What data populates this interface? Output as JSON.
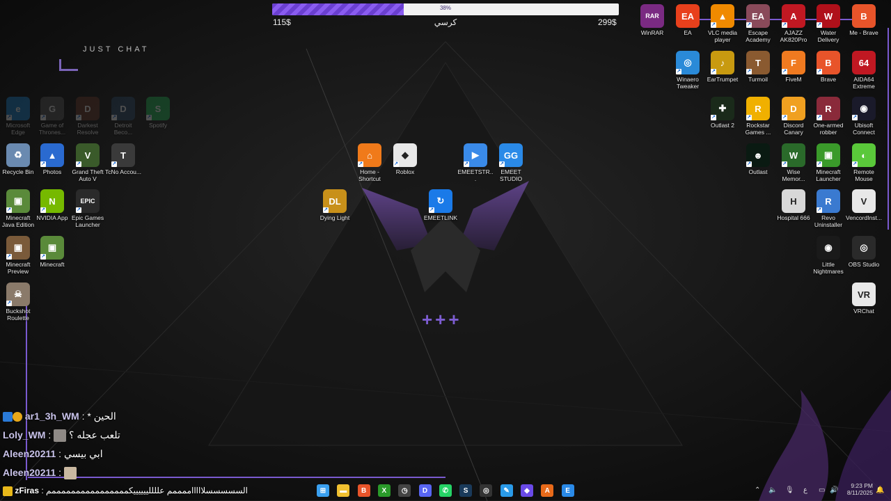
{
  "goal": {
    "percent_label": "38%",
    "progress": 0.38,
    "left_value": "115$",
    "title": "كرسي",
    "right_value": "299$"
  },
  "overlay": {
    "just_chat": "JUST CHAT",
    "plus": "+++"
  },
  "desktop_icons": [
    {
      "id": "winrar",
      "label": "WinRAR",
      "color": "#7a2a82",
      "glyph": "RAR"
    },
    {
      "id": "ea",
      "label": "EA",
      "color": "#e8401c",
      "glyph": "EA"
    },
    {
      "id": "vlc",
      "label": "VLC media player",
      "color": "#f08a00",
      "glyph": "▲"
    },
    {
      "id": "escape",
      "label": "Escape Academy",
      "color": "#8a4a5a",
      "glyph": "EA"
    },
    {
      "id": "ajazz",
      "label": "AJAZZ AK820Pro",
      "color": "#c01822",
      "glyph": "A"
    },
    {
      "id": "water",
      "label": "Water Delivery",
      "color": "#b0101a",
      "glyph": "W"
    },
    {
      "id": "brave-me",
      "label": "Me - Brave",
      "color": "#e8542a",
      "glyph": "B"
    },
    {
      "id": "winaero",
      "label": "Winaero Tweaker",
      "color": "#2a8ad8",
      "glyph": "◎"
    },
    {
      "id": "eartrumpet",
      "label": "EarTrumpet",
      "color": "#c89a10",
      "glyph": "♪"
    },
    {
      "id": "turmoil",
      "label": "Turmoil",
      "color": "#8a5a30",
      "glyph": "T"
    },
    {
      "id": "fivem",
      "label": "FiveM",
      "color": "#f07a20",
      "glyph": "F"
    },
    {
      "id": "brave",
      "label": "Brave",
      "color": "#e8542a",
      "glyph": "B"
    },
    {
      "id": "aida",
      "label": "AIDA64 Extreme",
      "color": "#c01822",
      "glyph": "64"
    },
    {
      "id": "outlast2",
      "label": "Outlast 2",
      "color": "#1a2a1a",
      "glyph": "✚"
    },
    {
      "id": "rockstar",
      "label": "Rockstar Games ...",
      "color": "#f0b000",
      "glyph": "R"
    },
    {
      "id": "discord-canary",
      "label": "Discord Canary",
      "color": "#f0a020",
      "glyph": "D"
    },
    {
      "id": "one-armed",
      "label": "One-armed robber",
      "color": "#8a2a3a",
      "glyph": "R"
    },
    {
      "id": "ubisoft",
      "label": "Ubisoft Connect",
      "color": "#1a1a2a",
      "glyph": "◉"
    },
    {
      "id": "outlast",
      "label": "Outlast",
      "color": "#0a1a12",
      "glyph": "☻"
    },
    {
      "id": "wise",
      "label": "Wise Memor...",
      "color": "#2a6a2a",
      "glyph": "W"
    },
    {
      "id": "mclauncher",
      "label": "Minecraft Launcher",
      "color": "#3a9a2a",
      "glyph": "▣"
    },
    {
      "id": "remote",
      "label": "Remote Mouse",
      "color": "#5ac83a",
      "glyph": "◐"
    },
    {
      "id": "hospital",
      "label": "Hospital 666",
      "color": "#d8d8d8",
      "glyph": "H"
    },
    {
      "id": "revo",
      "label": "Revo Uninstaller",
      "color": "#3a7ad0",
      "glyph": "R"
    },
    {
      "id": "vencord",
      "label": "VencordInst...",
      "color": "#e8e8e8",
      "glyph": "V"
    },
    {
      "id": "little",
      "label": "Little Nightmares",
      "color": "#1a1a1a",
      "glyph": "◉"
    },
    {
      "id": "obs",
      "label": "OBS Studio",
      "color": "#2a2a2a",
      "glyph": "◎"
    },
    {
      "id": "vrchat",
      "label": "VRChat",
      "color": "#e8e8e8",
      "glyph": "VR"
    },
    {
      "id": "edge",
      "label": "Microsoft Edge",
      "color": "#1a8ad8",
      "glyph": "e"
    },
    {
      "id": "got",
      "label": "Game of Thrones...",
      "color": "#5a5a5a",
      "glyph": "G"
    },
    {
      "id": "darkest",
      "label": "Darkest Resolve",
      "color": "#6a3a2a",
      "glyph": "D"
    },
    {
      "id": "detroit",
      "label": "Detroit Beco...",
      "color": "#2a4a6a",
      "glyph": "D"
    },
    {
      "id": "spotify",
      "label": "Spotify",
      "color": "#1db954",
      "glyph": "S"
    },
    {
      "id": "recycle",
      "label": "Recycle Bin",
      "color": "#6a8ab0",
      "glyph": "♻"
    },
    {
      "id": "photos",
      "label": "Photos",
      "color": "#2a6ad0",
      "glyph": "▲"
    },
    {
      "id": "gta",
      "label": "Grand Theft Auto V",
      "color": "#3a5a2a",
      "glyph": "V"
    },
    {
      "id": "tcno",
      "label": "TcNo Accou...",
      "color": "#3a3a3a",
      "glyph": "T"
    },
    {
      "id": "mcjava",
      "label": "Minecraft Java Edition",
      "color": "#5a8a3a",
      "glyph": "▣"
    },
    {
      "id": "nvidia",
      "label": "NVIDIA App",
      "color": "#76b900",
      "glyph": "N"
    },
    {
      "id": "epic",
      "label": "Epic Games Launcher",
      "color": "#2a2a2a",
      "glyph": "EPIC"
    },
    {
      "id": "mcpreview",
      "label": "Minecraft Preview",
      "color": "#7a5a3a",
      "glyph": "▣"
    },
    {
      "id": "minecraft",
      "label": "Minecraft",
      "color": "#5a8a3a",
      "glyph": "▣"
    },
    {
      "id": "buckshot",
      "label": "Buckshot Roulette",
      "color": "#8a7a6a",
      "glyph": "☠"
    },
    {
      "id": "home",
      "label": "Home - Shortcut",
      "color": "#f07a1a",
      "glyph": "⌂"
    },
    {
      "id": "roblox",
      "label": "Roblox",
      "color": "#e8e8e8",
      "glyph": "◆"
    },
    {
      "id": "emeetstr",
      "label": "EMEETSTR...",
      "color": "#3a8ae8",
      "glyph": "▶"
    },
    {
      "id": "emeet",
      "label": "EMEET STUDIO",
      "color": "#2a8ae8",
      "glyph": "GG"
    },
    {
      "id": "dying",
      "label": "Dying Light",
      "color": "#c8901a",
      "glyph": "DL"
    },
    {
      "id": "emeetlink",
      "label": "EMEETLINK",
      "color": "#1a7ae8",
      "glyph": "↻"
    }
  ],
  "chat": [
    {
      "user": "ar1_3h_WM",
      "message": "* الحين"
    },
    {
      "user": "Loly_WM",
      "message": "تلعب عجله ؟"
    },
    {
      "user": "Aleen20211",
      "message": "ابي بيسي"
    },
    {
      "user": "Aleen20211",
      "message": ""
    },
    {
      "user": "zFiras",
      "message": "السسسسسلاااااممممم عللللييييييكممممممممممممممممم"
    }
  ],
  "taskbar": {
    "apps": [
      "windows-start",
      "file-explorer",
      "brave",
      "xbox",
      "clock",
      "discord",
      "whatsapp",
      "steam",
      "obs",
      "paint",
      "arrow",
      "ajazz",
      "emeet"
    ],
    "time": "9:23 PM",
    "date": "8/11/2025",
    "lang": "ع"
  }
}
